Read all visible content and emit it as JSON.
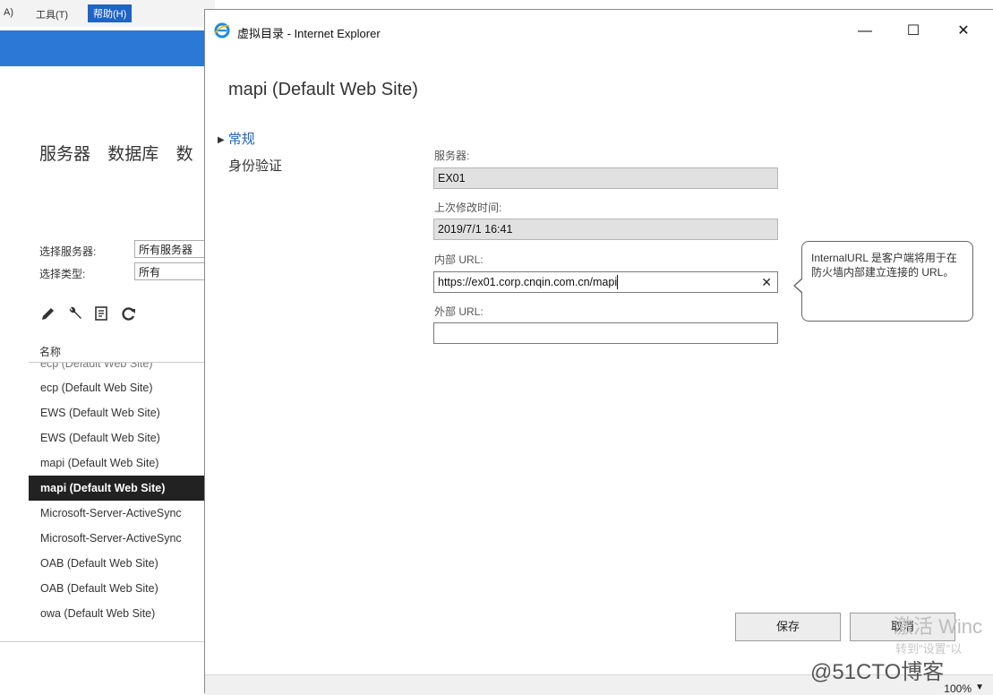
{
  "background": {
    "menu": {
      "item_a": "A)",
      "tools": "工具(T)",
      "help": "帮助(H)"
    },
    "nav_tabs": [
      "服务器",
      "数据库",
      "数"
    ],
    "filters": {
      "server_label": "选择服务器:",
      "server_value": "所有服务器",
      "type_label": "选择类型:",
      "type_value": "所有"
    },
    "toolbar_icons": [
      "edit-icon",
      "wrench-icon",
      "details-icon",
      "refresh-icon"
    ],
    "list_header": "名称",
    "list_items": [
      "ecp (Default Web Site)",
      "ecp (Default Web Site)",
      "EWS (Default Web Site)",
      "EWS (Default Web Site)",
      "mapi (Default Web Site)",
      "mapi (Default Web Site)",
      "Microsoft-Server-ActiveSync",
      "Microsoft-Server-ActiveSync",
      "OAB (Default Web Site)",
      "OAB (Default Web Site)",
      "owa (Default Web Site)"
    ],
    "selected_index": 5
  },
  "window": {
    "title": "虚拟目录 - Internet Explorer",
    "buttons": {
      "minimize": "—",
      "maximize": "☐",
      "close": "✕"
    }
  },
  "dialog": {
    "title": "mapi (Default Web Site)",
    "sections": {
      "general": "常规",
      "auth": "身份验证"
    },
    "fields": {
      "server_label": "服务器:",
      "server_value": "EX01",
      "modified_label": "上次修改时间:",
      "modified_value": "2019/7/1 16:41",
      "internal_label": "内部 URL:",
      "internal_value": "https://ex01.corp.cnqin.com.cn/mapi",
      "external_label": "外部 URL:",
      "external_value": ""
    },
    "tooltip": "InternalURL 是客户端将用于在防火墙内部建立连接的 URL。",
    "save_label": "保存",
    "cancel_label": "取消"
  },
  "status": {
    "zoom": "100%"
  },
  "watermarks": {
    "activate": "激活 Winc",
    "activate_sub": "转到\"设置\"以",
    "blog": "@51CTO博客"
  }
}
